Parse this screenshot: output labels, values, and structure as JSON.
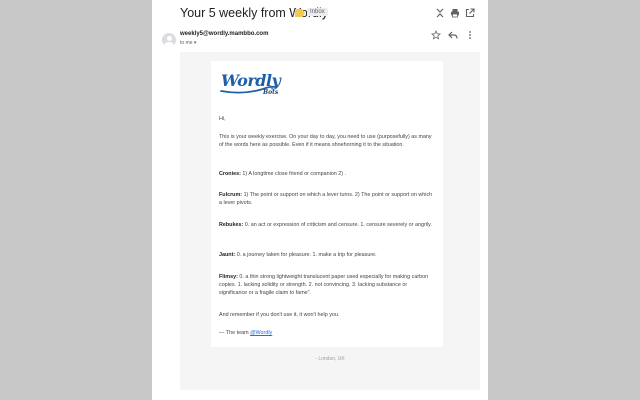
{
  "subject": "Your 5 weekly from Wordly",
  "label": "Inbox",
  "sender": "weekly5@wordly.mambbo.com",
  "to_line": "to me ▾",
  "greeting": "Hi,",
  "intro": "This is your weekly exercise. On your day to day, you need to use (purposefully) as many of the words here as possible. Even if it means shoehorning it to the situation.",
  "words": [
    {
      "term": "Cronies:",
      "definition": "1) A longtime close friend or companion 2) ."
    },
    {
      "term": "Fulcrum:",
      "definition": "1) The point or support on which a lever turns. 2) The point or support on which a lever pivots."
    },
    {
      "term": "Rebukes:",
      "definition": "0. an act or expression of criticism and censure. 1. censure severely or angrily."
    },
    {
      "term": "Jaunt:",
      "definition": "0. a journey taken for pleasure. 1. make a trip for pleasure."
    },
    {
      "term": "Flimsy:",
      "definition": "0. a thin strong lightweight translucent paper used especially for making carbon copies. 1. lacking solidity or strength. 2. not convincing. 3. lacking substance or significance or a fragile claim to fame\"."
    }
  ],
  "closing": "And remember if you don't use it, it won't help you.",
  "signoff": "— The team",
  "signoff_link": "@Wordly",
  "footer": "- London, UK",
  "logo": {
    "word": "Wordly",
    "sub": "Bots"
  },
  "colors": {
    "brand": "#1f5fa8",
    "link": "#1a73e8",
    "canvas": "#f5f5f5"
  },
  "icons": {
    "top": [
      "collapse-icon",
      "print-icon",
      "open-in-new-icon"
    ],
    "sender_actions": [
      "star-icon",
      "reply-icon",
      "more-vert-icon"
    ],
    "label": "label-icon"
  }
}
